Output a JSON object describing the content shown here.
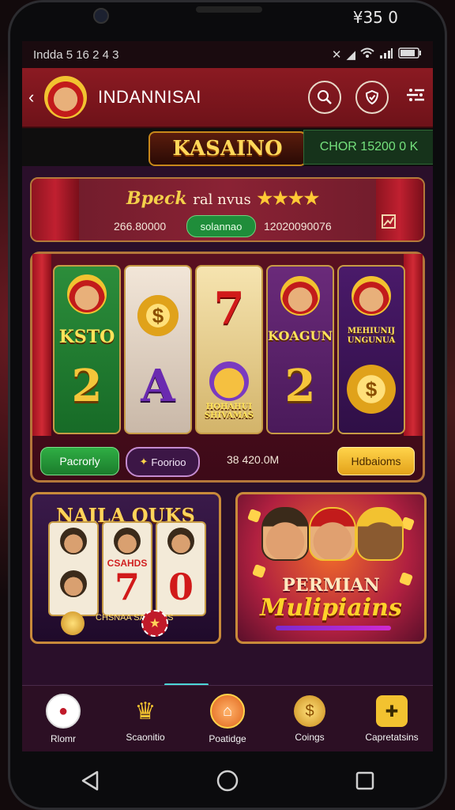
{
  "device": {
    "top_clock": "¥35 0"
  },
  "statusbar": {
    "left_text": "Indda 5 16 2 4 3"
  },
  "header": {
    "title": "INDANNISAI",
    "back_icon": "chevron-left-icon",
    "search_icon": "search-icon",
    "shield_icon": "shield-icon",
    "menu_icon": "menu-icon"
  },
  "brand": {
    "logo_text": "KASAINO",
    "balance": "CHOR 15200 0 K"
  },
  "promo": {
    "title": "Bpeck",
    "subtitle": "ral nvus",
    "stars": "★★★★",
    "value_left": "266.80000",
    "badge": "solannao",
    "value_right": "12020090076",
    "icon": "chart-icon"
  },
  "slot": {
    "reels": [
      {
        "top_label": "KSTO",
        "bottom": "2"
      },
      {
        "top_label": "",
        "bottom": "A"
      },
      {
        "top_label": "7",
        "bottom_label": "HOHAHUI SHIVAMAS"
      },
      {
        "top_label": "KOAGUN",
        "bottom": "2"
      },
      {
        "top_label": "MEHIUNIJ UNGUNUA",
        "bottom": "$"
      }
    ],
    "controls": {
      "left_button": "Pacrorly",
      "mid_button": "Foorioo",
      "mid_value": "38 420.0M",
      "right_button": "Hdbaioms"
    }
  },
  "cards": [
    {
      "title": "NAILA OUKS",
      "reel_label": "CSAHDS",
      "footer": "CHSNAA SAIONOS"
    },
    {
      "title_top": "PERMIAN",
      "title_bottom": "Mulipiains"
    }
  ],
  "tabbar": {
    "items": [
      {
        "label": "Rlomr",
        "icon": "casino-chip-icon"
      },
      {
        "label": "Scaonitio",
        "icon": "trophy-icon"
      },
      {
        "label": "Poatidge",
        "icon": "bag-icon"
      },
      {
        "label": "Coings",
        "icon": "coin-icon"
      },
      {
        "label": "Capretatsins",
        "icon": "controller-icon"
      }
    ]
  },
  "navbar": {
    "back_icon": "triangle-back-icon",
    "home_icon": "circle-home-icon",
    "recent_icon": "square-recent-icon"
  },
  "colors": {
    "header_red": "#8b1a22",
    "accent_gold": "#f2c230",
    "green": "#1f8d3a",
    "purple": "#2a0f2a"
  }
}
